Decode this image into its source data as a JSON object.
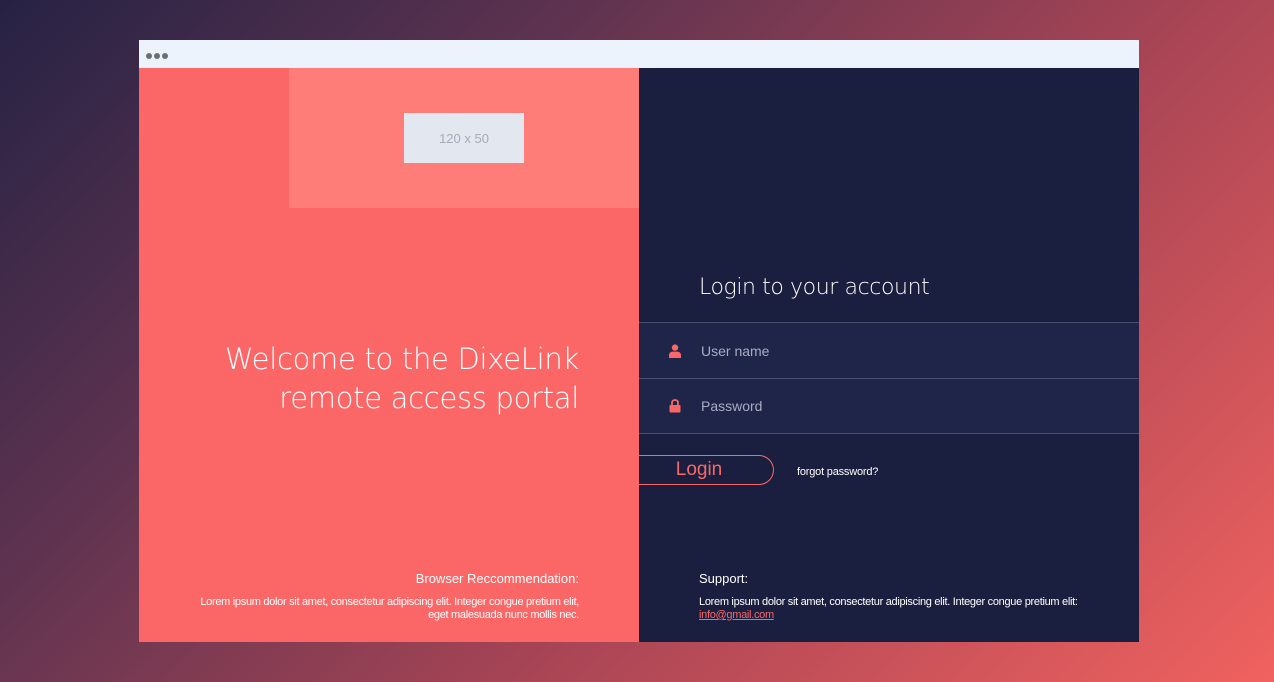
{
  "colors": {
    "accent": "#fb6767",
    "dark_panel": "#1b1f3f",
    "titlebar": "#edf3fd"
  },
  "left_panel": {
    "logo_placeholder": "120 x 50",
    "welcome_line1": "Welcome to the DixeLink",
    "welcome_line2": "remote access portal",
    "browser_heading": "Browser Reccommendation:",
    "browser_text": "Lorem ipsum dolor sit amet, consectetur adipiscing elit. Integer congue pretium elit, eget malesuada nunc mollis nec."
  },
  "login": {
    "title": "Login to your account",
    "username_placeholder": "User name",
    "password_placeholder": "Password",
    "button_label": "Login",
    "forgot_label": "forgot password?",
    "username_icon": "user-icon",
    "password_icon": "lock-icon"
  },
  "support": {
    "heading": "Support:",
    "text": "Lorem ipsum dolor sit amet, consectetur adipiscing elit. Integer congue pretium elit: ",
    "email": "info@gmail.com"
  }
}
